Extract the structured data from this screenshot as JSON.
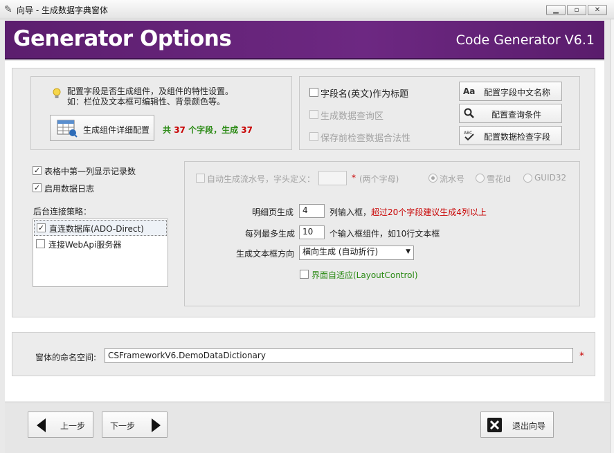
{
  "window": {
    "title": "向导 - 生成数据字典窗体",
    "icon": "wand-icon",
    "controls": [
      "minimize",
      "maximize",
      "close"
    ]
  },
  "banner": {
    "title": "Generator Options",
    "subtitle": "Code Generator V6.1"
  },
  "options": {
    "hint_line1": "配置字段是否生成组件，及组件的特性设置。",
    "hint_line2": "如：栏位及文本框可编辑性、背景颜色等。",
    "detail_button": "生成组件详细配置",
    "count_prefix": "共",
    "total_fields": "37",
    "count_mid": "个字段，生成",
    "generated_fields": "37"
  },
  "right_options": {
    "use_field_name_title": {
      "label": "字段名(英文)作为标题",
      "checked": false
    },
    "gen_query": {
      "label": "生成数据查询区",
      "checked": false,
      "disabled": true
    },
    "validate_before_save": {
      "label": "保存前检查数据合法性",
      "checked": false,
      "disabled": true
    },
    "btn_cn_names": "配置字段中文名称",
    "btn_query": "配置查询条件",
    "btn_validate": "配置数据检查字段"
  },
  "left_options": {
    "show_record_count": {
      "label": "表格中第一列显示记录数",
      "checked": true
    },
    "enable_log": {
      "label": "启用数据日志",
      "checked": true
    },
    "strategy_label": "后台连接策略：",
    "strategies": [
      {
        "label": "直连数据库(ADO-Direct)",
        "checked": true
      },
      {
        "label": "连接WebApi服务器",
        "checked": false
      }
    ]
  },
  "serial": {
    "label": "自动生成流水号，字头定义：",
    "prefix_value": "",
    "required_mark": "*",
    "hint": "(两个字母)",
    "radios": [
      {
        "label": "流水号",
        "selected": true
      },
      {
        "label": "雪花Id",
        "selected": false
      },
      {
        "label": "GUID32",
        "selected": false
      }
    ]
  },
  "layout_cfg": {
    "detail_label": "明细页生成",
    "detail_cols": "4",
    "detail_suffix": "列输入框，",
    "detail_warning": "超过20个字段建议生成4列以上",
    "per_col_label": "每列最多生成",
    "per_col_value": "10",
    "per_col_suffix": "个输入框组件，如10行文本框",
    "direction_label": "生成文本框方向",
    "direction_value": "横向生成 (自动折行)",
    "adaptive": {
      "label": "界面自适应(LayoutControl)",
      "checked": false
    }
  },
  "namespace": {
    "label": "窗体的命名空间:",
    "value": "CSFrameworkV6.DemoDataDictionary",
    "required_mark": "*"
  },
  "footer": {
    "prev": "上一步",
    "next": "下一步",
    "exit": "退出向导"
  },
  "colors": {
    "banner": "#6a2580",
    "warning": "#c80000",
    "count_green": "#2a8a14"
  }
}
